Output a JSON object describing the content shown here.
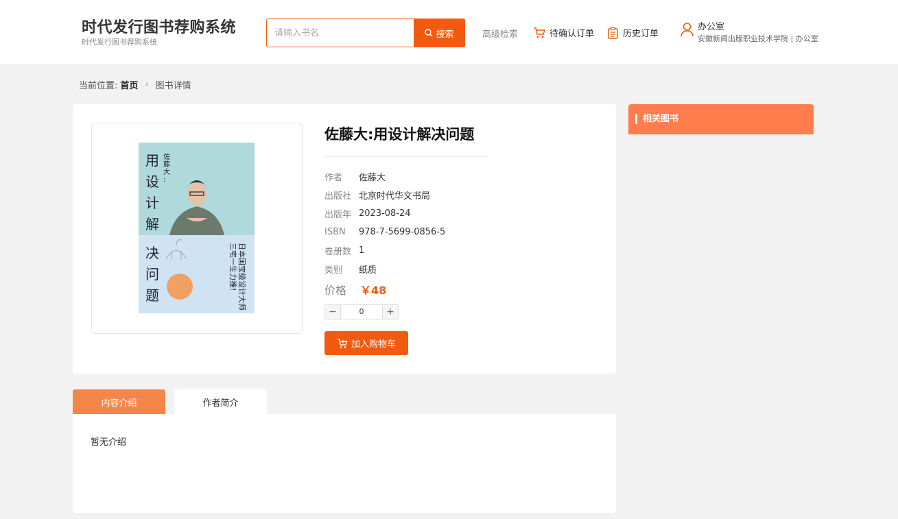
{
  "header": {
    "brand_title": "时代发行图书荐购系统",
    "brand_sub": "时代发行图书荐购系统",
    "search_placeholder": "请输入书名",
    "search_label": "搜索",
    "advanced_search": "高级检索",
    "pending_orders": "待确认订单",
    "history_orders": "历史订单",
    "user_name": "办公室",
    "user_org": "安徽新闻出版职业技术学院 | 办公室"
  },
  "breadcrumb": {
    "prefix": "当前位置:",
    "home": "首页",
    "current": "图书详情"
  },
  "book": {
    "title": "佐藤大:用设计解决问题",
    "fields": [
      {
        "label": "作者",
        "value": "佐藤大"
      },
      {
        "label": "出版社",
        "value": "北京时代华文书局"
      },
      {
        "label": "出版年",
        "value": "2023-08-24"
      },
      {
        "label": "ISBN",
        "value": "978-7-5699-0856-5"
      },
      {
        "label": "卷册数",
        "value": "1"
      },
      {
        "label": "类别",
        "value": "纸质"
      }
    ],
    "price_label": "价格",
    "price": "￥48",
    "quantity": "0",
    "add_to_cart": "加入购物车"
  },
  "cover": {
    "title_chars": [
      "用",
      "设",
      "计",
      "解",
      "决",
      "问",
      "题"
    ],
    "author_chars": [
      "佐",
      "藤",
      "大",
      ":"
    ],
    "tagline_1": "日本国宝级设计大师",
    "tagline_2": "三宅一生力推!",
    "colors": {
      "top": "#b0d9dc",
      "bottom": "#cfe3f2",
      "badge": "#f0a060"
    }
  },
  "related": {
    "title": "相关图书"
  },
  "tabs": {
    "intro": "内容介绍",
    "author": "作者简介",
    "content": "暂无介绍"
  },
  "colors": {
    "accent": "#f25a10",
    "related_header": "#ff7d4d",
    "tab_active": "#f5864a"
  }
}
